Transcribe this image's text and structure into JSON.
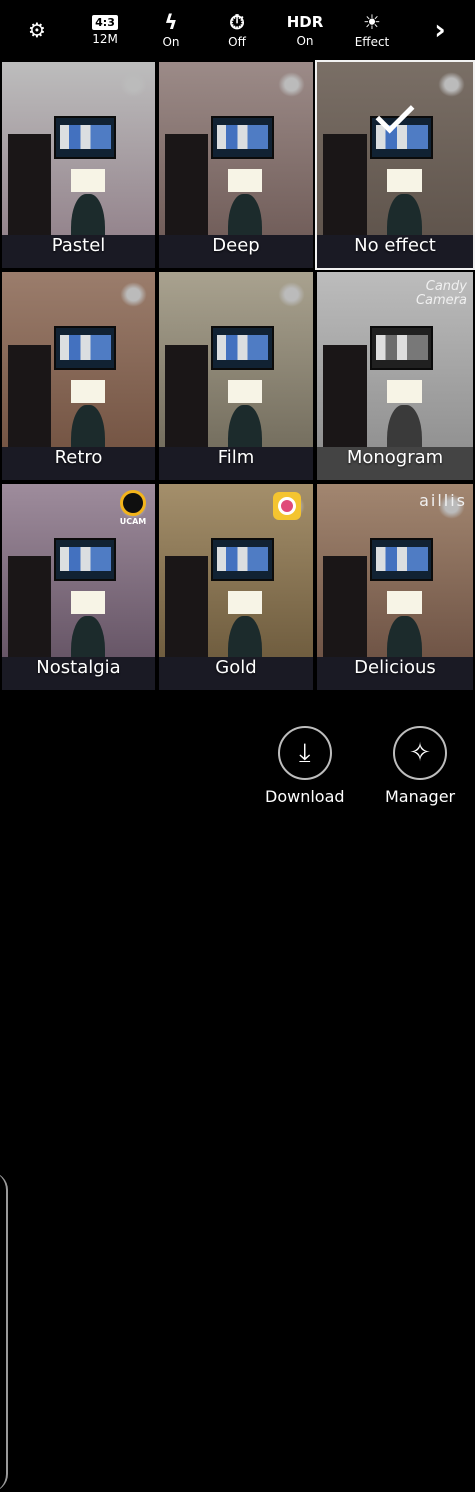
{
  "topbar": {
    "settings_icon": "gear-icon",
    "size": {
      "badge": "4:3",
      "value": "12M"
    },
    "flash": {
      "icon": "flash-icon",
      "value": "On"
    },
    "timer": {
      "icon": "timer-icon",
      "value": "Off"
    },
    "hdr": {
      "label": "HDR",
      "value": "On"
    },
    "effect": {
      "icon": "effect-icon",
      "label": "Effect"
    },
    "next_icon": "chevron-right-icon"
  },
  "effects": [
    {
      "label": "Pastel",
      "tint": "#8d7a84"
    },
    {
      "label": "Deep",
      "tint": "#76605a"
    },
    {
      "label": "No effect",
      "tint": "#6c6258",
      "selected": true
    },
    {
      "label": "Retro",
      "tint": "#7f5f4c"
    },
    {
      "label": "Film",
      "tint": "#7c7566"
    },
    {
      "label": "Monogram",
      "tint": "#9d9d9d",
      "brand": "Candy\nCamera"
    },
    {
      "label": "Nostalgia",
      "tint": "#6f5a6f",
      "brand_logo": "UCAM"
    },
    {
      "label": "Gold",
      "tint": "#7a6a4e"
    },
    {
      "label": "Delicious",
      "tint": "#7c6256",
      "brand": "aillis"
    }
  ],
  "actions": {
    "download": {
      "label": "Download",
      "icon": "download-icon"
    },
    "manager": {
      "label": "Manager",
      "icon": "magic-wand-icon"
    }
  }
}
